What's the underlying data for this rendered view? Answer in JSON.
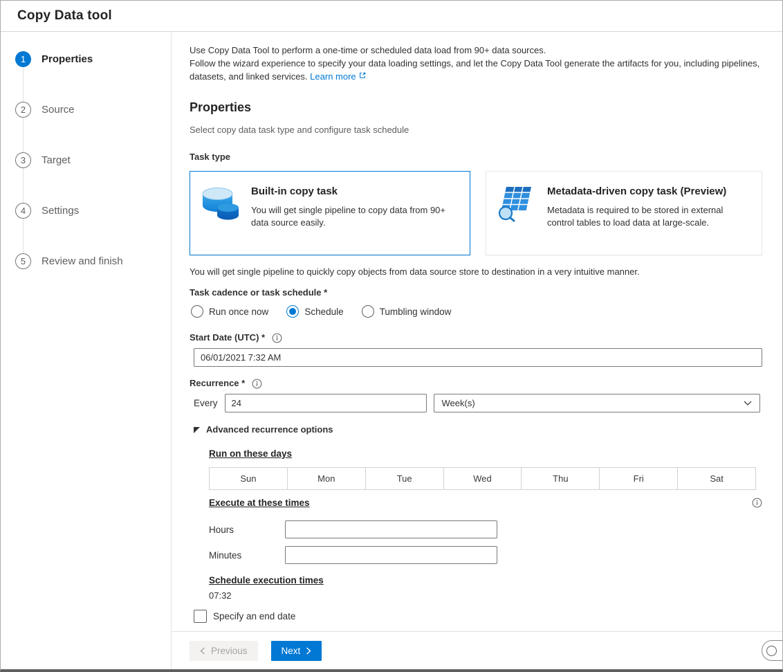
{
  "window": {
    "title": "Copy Data tool"
  },
  "wizard": {
    "steps": [
      {
        "number": "1",
        "label": "Properties",
        "active": true
      },
      {
        "number": "2",
        "label": "Source",
        "active": false
      },
      {
        "number": "3",
        "label": "Target",
        "active": false
      },
      {
        "number": "4",
        "label": "Settings",
        "active": false
      },
      {
        "number": "5",
        "label": "Review and finish",
        "active": false
      }
    ]
  },
  "intro": {
    "line1": "Use Copy Data Tool to perform a one-time or scheduled data load from 90+ data sources.",
    "line2": "Follow the wizard experience to specify your data loading settings, and let the Copy Data Tool generate the artifacts for you, including pipelines, datasets, and linked services.",
    "learn_more_label": "Learn more"
  },
  "properties": {
    "heading": "Properties",
    "subheading": "Select copy data task type and configure task schedule",
    "task_type_label": "Task type",
    "task_cards": [
      {
        "title": "Built-in copy task",
        "description": "You will get single pipeline to copy data from 90+ data source easily.",
        "selected": true
      },
      {
        "title": "Metadata-driven copy task (Preview)",
        "description": "Metadata is required to be stored in external control tables to load data at large-scale.",
        "selected": false
      }
    ],
    "task_note": "You will get single pipeline to quickly copy objects from data source store to destination in a very intuitive manner."
  },
  "schedule": {
    "cadence_label": "Task cadence or task schedule *",
    "cadence_options": [
      {
        "label": "Run once now",
        "selected": false
      },
      {
        "label": "Schedule",
        "selected": true
      },
      {
        "label": "Tumbling window",
        "selected": false
      }
    ],
    "start_date_label": "Start Date (UTC) *",
    "start_date_value": "06/01/2021 7:32 AM",
    "recurrence_label": "Recurrence *",
    "every_label": "Every",
    "interval_value": "24",
    "frequency_value": "Week(s)",
    "advanced_options_label": "Advanced recurrence options",
    "run_on_days_label": "Run on these days",
    "weekdays": [
      "Sun",
      "Mon",
      "Tue",
      "Wed",
      "Thu",
      "Fri",
      "Sat"
    ],
    "execute_times_label": "Execute at these times",
    "hours_label": "Hours",
    "hours_value": "",
    "minutes_label": "Minutes",
    "minutes_value": "",
    "execution_times_label": "Schedule execution times",
    "execution_times_value": "07:32",
    "end_date_label": "Specify an end date",
    "end_date_checked": false
  },
  "footer": {
    "previous_label": "Previous",
    "next_label": "Next"
  },
  "colors": {
    "accent": "#0078d4",
    "text_primary": "#252423",
    "text_secondary": "#605e5c",
    "selected_card_border": "#0078d4"
  }
}
